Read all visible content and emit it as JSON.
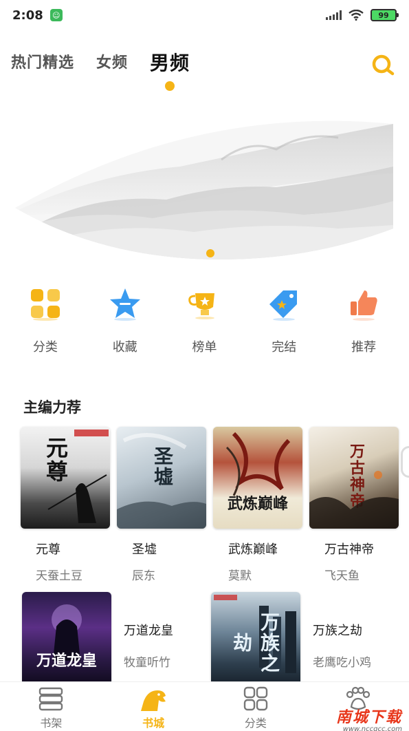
{
  "status_bar": {
    "time": "2:08",
    "battery": "99"
  },
  "tabs": [
    {
      "label": "热门精选",
      "active": false
    },
    {
      "label": "女频",
      "active": false
    },
    {
      "label": "男频",
      "active": true
    }
  ],
  "quick_nav": [
    {
      "label": "分类",
      "icon": "category-grid-icon"
    },
    {
      "label": "收藏",
      "icon": "star-icon"
    },
    {
      "label": "榜单",
      "icon": "trophy-icon"
    },
    {
      "label": "完结",
      "icon": "tag-star-icon"
    },
    {
      "label": "推荐",
      "icon": "thumbs-up-icon"
    }
  ],
  "section": {
    "title": "主编力荐"
  },
  "books_row1": [
    {
      "title": "元尊",
      "author": "天蚕土豆",
      "cover_text": "元尊"
    },
    {
      "title": "圣墟",
      "author": "辰东",
      "cover_text": "圣墟"
    },
    {
      "title": "武炼巅峰",
      "author": "莫默",
      "cover_text": "武炼巅峰"
    },
    {
      "title": "万古神帝",
      "author": "飞天鱼",
      "cover_text": "万古神帝"
    }
  ],
  "books_row2": [
    {
      "title": "万道龙皇",
      "author": "牧童听竹",
      "cover_text": "万道龙皇"
    },
    {
      "title": "万族之劫",
      "author": "老鹰吃小鸡",
      "cover_text": "万族之劫"
    }
  ],
  "bottom_nav": [
    {
      "label": "书架",
      "active": false
    },
    {
      "label": "书城",
      "active": true
    },
    {
      "label": "分类",
      "active": false
    },
    {
      "label": "",
      "active": false
    }
  ],
  "watermark": {
    "main": "南城下载",
    "sub": "www.nccgcc.com"
  },
  "colors": {
    "accent": "#f5b416",
    "primary_text": "#222222",
    "secondary_text": "#777777"
  }
}
